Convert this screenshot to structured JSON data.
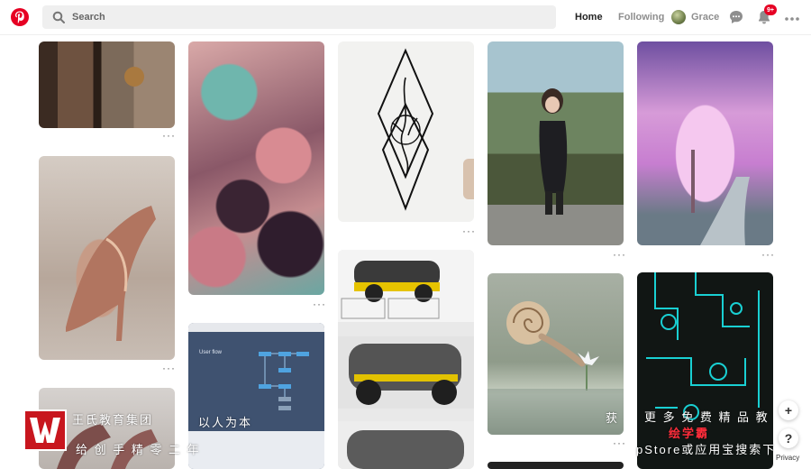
{
  "header": {
    "search_placeholder": "Search",
    "nav_home": "Home",
    "nav_following": "Following",
    "user_name": "Grace",
    "notification_count": "9+"
  },
  "pins": [
    {
      "id": "p1",
      "subject": "rustic wooden door with baskets"
    },
    {
      "id": "p2",
      "subject": "pink teal abstract texture"
    },
    {
      "id": "p3",
      "subject": "geometric tree line tattoo drawing"
    },
    {
      "id": "p4",
      "subject": "girl crouching in garden"
    },
    {
      "id": "p5",
      "subject": "pink blossom trees path"
    },
    {
      "id": "p6",
      "subject": "rose gold high heel shoe"
    },
    {
      "id": "p7",
      "subject": "user flow diagram slide",
      "label": "User flow"
    },
    {
      "id": "p8",
      "subject": "futuristic vehicle concept sketches"
    },
    {
      "id": "p9",
      "subject": "snail reaching white flower"
    },
    {
      "id": "p10",
      "subject": "cyan circuit line art poster"
    },
    {
      "id": "p11",
      "subject": "high heels"
    },
    {
      "id": "p12",
      "subject": "dark image"
    }
  ],
  "pin_more_label": "···",
  "watermark": {
    "line1a": "王氏教育集团",
    "line1b": "以人为本",
    "line2": "给 创 手 精 零 二 年",
    "line3a": "获",
    "line3b": "更 多 免 费 精 品 教",
    "line3c": "绘学霸",
    "line4": "pStore或应用宝搜索下"
  },
  "floating": {
    "add_label": "+",
    "help_label": "?",
    "privacy_label": "Privacy"
  },
  "colors": {
    "brand": "#e60023",
    "badge": "#e60023",
    "nav_active": "#222222",
    "nav_inactive": "#8e8e8e"
  }
}
